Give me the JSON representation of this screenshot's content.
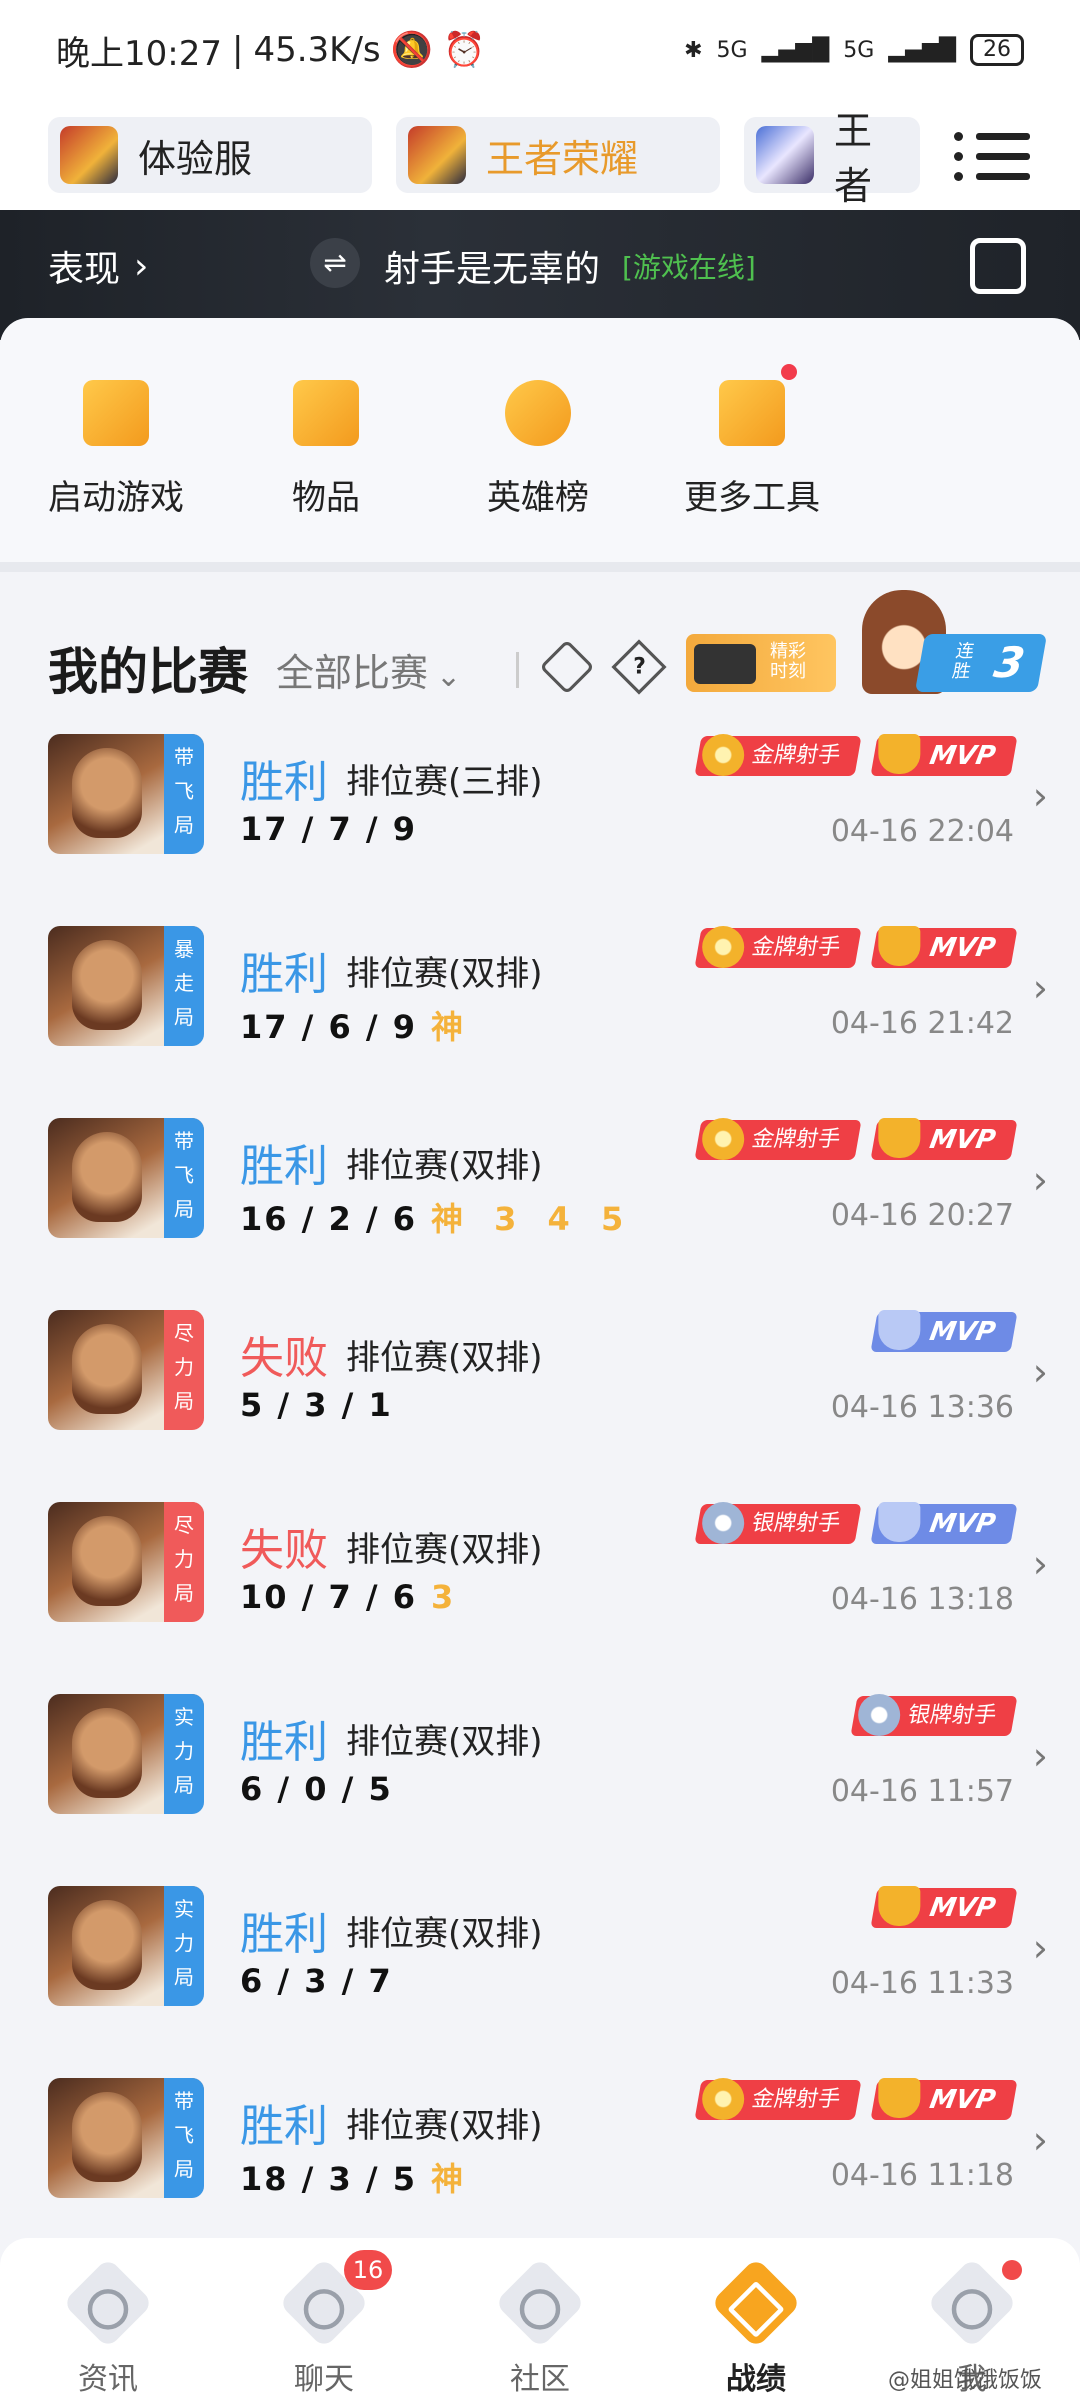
{
  "status_bar": {
    "time": "晚上10:27",
    "speed": "45.3K/s",
    "network1": "5G",
    "network2": "5G",
    "battery": "26"
  },
  "game_tabs": [
    {
      "label": "体验服"
    },
    {
      "label": "王者荣耀"
    },
    {
      "label": "王者"
    }
  ],
  "banner": {
    "perf_label": "表现",
    "swap_symbol": "⇌",
    "player_name": "射手是无辜的",
    "online_status": "[游戏在线]"
  },
  "tools": [
    {
      "label": "启动游戏",
      "icon": "play-game-icon"
    },
    {
      "label": "物品",
      "icon": "items-icon"
    },
    {
      "label": "英雄榜",
      "icon": "hero-rank-icon"
    },
    {
      "label": "更多工具",
      "icon": "more-tools-icon"
    }
  ],
  "matches_header": {
    "title": "我的比赛",
    "filter": "全部比赛",
    "question_mark": "?",
    "highlight_line1": "精彩",
    "highlight_line2": "时刻",
    "streak_line1": "连",
    "streak_line2": "胜",
    "streak_count": "3"
  },
  "matches": [
    {
      "tag": "带飞局",
      "tag_color": "blue",
      "result": "胜利",
      "result_type": "win",
      "mode": "排位赛(三排)",
      "kda": "17 / 7 / 9",
      "extra": "",
      "badges": [
        "金牌射手",
        "MVP"
      ],
      "time": "04-16 22:04"
    },
    {
      "tag": "暴走局",
      "tag_color": "blue",
      "result": "胜利",
      "result_type": "win",
      "mode": "排位赛(双排)",
      "kda": "17 / 6 / 9",
      "extra": "神",
      "badges": [
        "金牌射手",
        "MVP"
      ],
      "time": "04-16 21:42"
    },
    {
      "tag": "带飞局",
      "tag_color": "blue",
      "result": "胜利",
      "result_type": "win",
      "mode": "排位赛(双排)",
      "kda": "16 / 2 / 6",
      "extra": "神 3 4 5",
      "badges": [
        "金牌射手",
        "MVP"
      ],
      "time": "04-16 20:27"
    },
    {
      "tag": "尽力局",
      "tag_color": "red",
      "result": "失败",
      "result_type": "lose",
      "mode": "排位赛(双排)",
      "kda": "5 / 3 / 1",
      "extra": "",
      "badges": [
        "MVP"
      ],
      "time": "04-16 13:36"
    },
    {
      "tag": "尽力局",
      "tag_color": "red",
      "result": "失败",
      "result_type": "lose",
      "mode": "排位赛(双排)",
      "kda": "10 / 7 / 6",
      "extra": "3",
      "badges": [
        "银牌射手",
        "MVP"
      ],
      "time": "04-16 13:18"
    },
    {
      "tag": "实力局",
      "tag_color": "blue",
      "result": "胜利",
      "result_type": "win",
      "mode": "排位赛(双排)",
      "kda": "6 / 0 / 5",
      "extra": "",
      "badges": [
        "银牌射手"
      ],
      "time": "04-16 11:57"
    },
    {
      "tag": "实力局",
      "tag_color": "blue",
      "result": "胜利",
      "result_type": "win",
      "mode": "排位赛(双排)",
      "kda": "6 / 3 / 7",
      "extra": "",
      "badges": [
        "MVP"
      ],
      "time": "04-16 11:33"
    },
    {
      "tag": "带飞局",
      "tag_color": "blue",
      "result": "胜利",
      "result_type": "win",
      "mode": "排位赛(双排)",
      "kda": "18 / 3 / 5",
      "extra": "神",
      "badges": [
        "金牌射手",
        "MVP"
      ],
      "time": "04-16 11:18"
    }
  ],
  "bottom_nav": [
    {
      "label": "资讯",
      "active": false,
      "count": ""
    },
    {
      "label": "聊天",
      "active": false,
      "count": "16"
    },
    {
      "label": "社区",
      "active": false,
      "count": ""
    },
    {
      "label": "战绩",
      "active": true,
      "count": ""
    },
    {
      "label": "我",
      "active": false,
      "count": ""
    }
  ],
  "watermark": "@姐姐饿饿饭饭",
  "colors": {
    "win_blue": "#3a97e6",
    "lose_red": "#f05a5a",
    "accent_orange": "#f8a51f",
    "badge_red": "#ef3f45"
  }
}
